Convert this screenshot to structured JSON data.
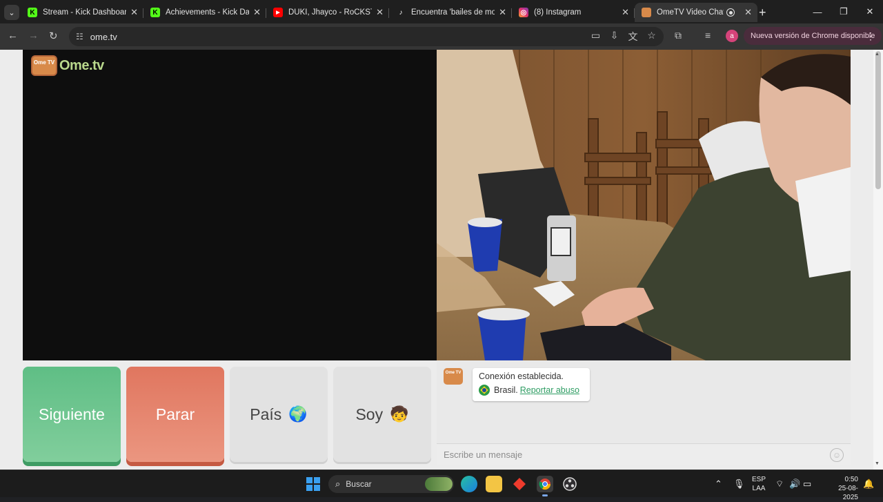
{
  "browser": {
    "tabs": [
      {
        "title": "Stream - Kick Dashboard",
        "favicon": "kick-icon",
        "color": "#53fc18"
      },
      {
        "title": "Achievements - Kick Dashbo",
        "favicon": "kick-icon",
        "color": "#53fc18"
      },
      {
        "title": "DUKI, Jhayco - RoCKSTAR",
        "favicon": "youtube-icon",
        "color": "#ff0000"
      },
      {
        "title": "Encuentra 'bailes de motin",
        "favicon": "tiktok-icon",
        "color": "#ffffff"
      },
      {
        "title": "(8) Instagram",
        "favicon": "instagram-icon",
        "color": "#e1306c"
      },
      {
        "title": "OmeTV Video Chat —",
        "favicon": "ometv-icon",
        "color": "#d88a4a",
        "active": true
      }
    ],
    "url": "ome.tv",
    "update_label": "Nueva versión de Chrome disponible",
    "profile_initial": "a"
  },
  "page": {
    "logo_text": "Ome.tv",
    "logo_badge": "Ome TV",
    "buttons": {
      "next": "Siguiente",
      "stop": "Parar",
      "country": "País",
      "country_emoji": "🌍",
      "gender": "Soy",
      "gender_emoji": "🧒"
    },
    "chat": {
      "status": "Conexión establecida.",
      "country": "Brasil.",
      "report_link": "Reportar abuso",
      "input_placeholder": "Escribe un mensaje"
    }
  },
  "taskbar": {
    "search_label": "Buscar",
    "lang_top": "ESP",
    "lang_bottom": "LAA",
    "time": "0:50",
    "date": "25-08-2025"
  }
}
